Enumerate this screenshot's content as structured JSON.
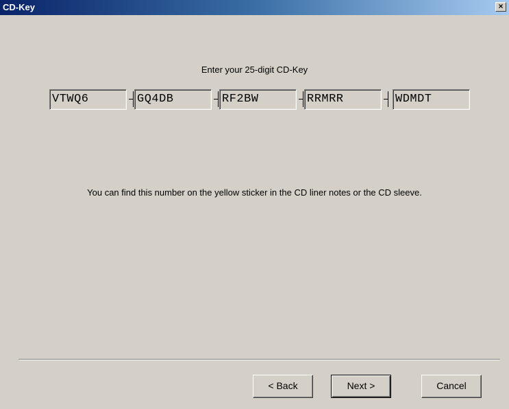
{
  "window": {
    "title": "CD-Key",
    "close_symbol": "×"
  },
  "prompt": "Enter your 25-digit CD-Key",
  "key_fields": [
    "VTWQ6",
    "GQ4DB",
    "RF2BW",
    "RRMRR",
    "WDMDT"
  ],
  "info": "You can find this number on the yellow sticker in the CD liner notes or the CD sleeve.",
  "buttons": {
    "back": "< Back",
    "next": "Next >",
    "cancel": "Cancel"
  },
  "colors": {
    "face": "#d4d0c8",
    "title_start": "#0a246a",
    "title_end": "#a6caf0"
  }
}
